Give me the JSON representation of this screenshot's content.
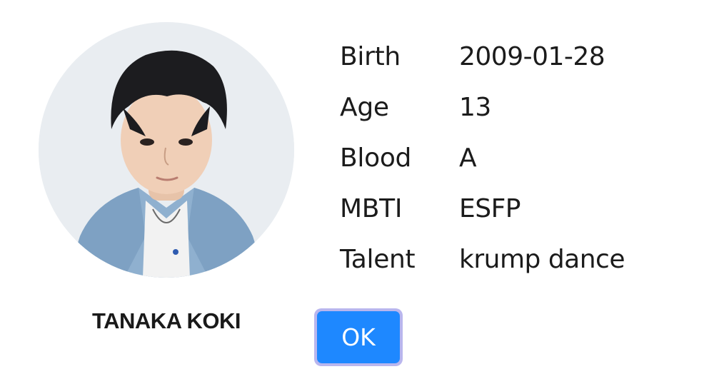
{
  "profile": {
    "name": "TANAKA KOKI",
    "photo_icon": "person-portrait"
  },
  "info": [
    {
      "label": "Birth",
      "value": "2009-01-28"
    },
    {
      "label": "Age",
      "value": "13"
    },
    {
      "label": "Blood",
      "value": "A"
    },
    {
      "label": "MBTI",
      "value": "ESFP"
    },
    {
      "label": "Talent",
      "value": "krump dance"
    }
  ],
  "actions": {
    "ok_label": "OK"
  },
  "colors": {
    "ok_button": "#1e88ff",
    "ok_button_focus_ring": "#b9b6ee",
    "text": "#1b1b1b",
    "background": "#ffffff"
  }
}
